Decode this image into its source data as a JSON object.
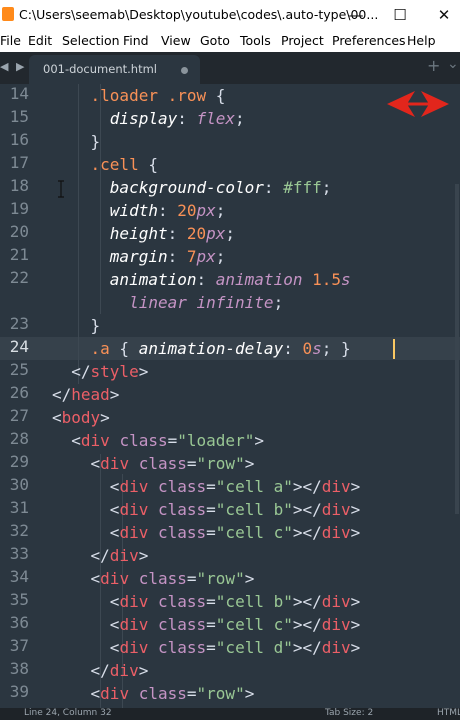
{
  "window": {
    "title": "C:\\Users\\seemab\\Desktop\\youtube\\codes\\.auto-type\\00...",
    "minimize_glyph": "—",
    "maximize_glyph": "☐",
    "close_glyph": "✕"
  },
  "menu": [
    "File",
    "Edit",
    "Selection",
    "Find",
    "View",
    "Goto",
    "Tools",
    "Project",
    "Preferences",
    "Help"
  ],
  "tabs": {
    "nav_arrows": "◀ ▶",
    "active_label": "001-document.html",
    "new_tab_glyph": "+",
    "overflow_glyph": "⌄"
  },
  "editor": {
    "active_line_number": "24",
    "gutter": [
      "14",
      "15",
      "16",
      "17",
      "18",
      "19",
      "20",
      "21",
      "22",
      "",
      "23",
      "24",
      "25",
      "26",
      "27",
      "28",
      "29",
      "30",
      "31",
      "32",
      "33",
      "34",
      "35",
      "36",
      "37",
      "38",
      "39"
    ],
    "colors": {
      "background": "#2b3640",
      "selector": "#f99157",
      "property": "#ffffff",
      "keyword_value": "#c594c5",
      "tag": "#ec5f67",
      "string": "#99c794",
      "caret": "#fac863"
    }
  },
  "status": {
    "position": "Line 24, Column 32",
    "tab_size": "Tab Size: 2",
    "syntax": "HTML"
  }
}
